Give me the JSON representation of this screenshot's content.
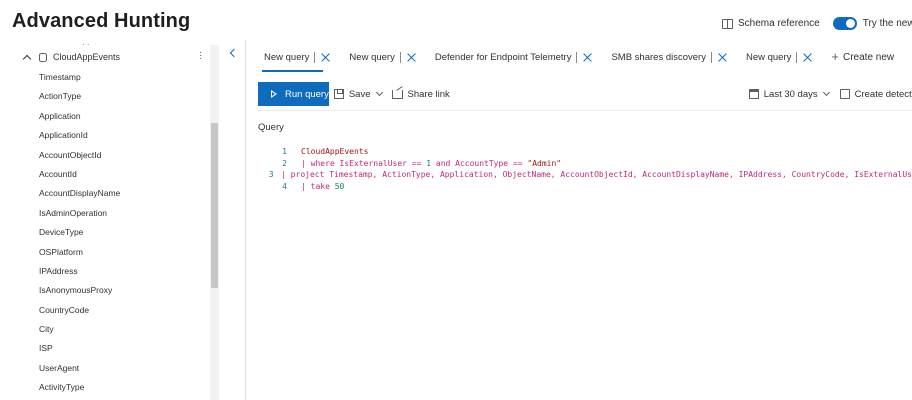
{
  "page": {
    "title": "Advanced Hunting"
  },
  "header": {
    "schema_reference": "Schema reference",
    "toggle_label": "Try the new Hunti",
    "toggle_on": true
  },
  "sidebar": {
    "group": "CloudAppEvents",
    "cut_text": "·  ·",
    "fields": [
      "Timestamp",
      "ActionType",
      "Application",
      "ApplicationId",
      "AccountObjectId",
      "AccountId",
      "AccountDisplayName",
      "IsAdminOperation",
      "DeviceType",
      "OSPlatform",
      "IPAddress",
      "IsAnonymousProxy",
      "CountryCode",
      "City",
      "ISP",
      "UserAgent",
      "ActivityType"
    ]
  },
  "tabs": [
    {
      "label": "New query",
      "active": true
    },
    {
      "label": "New query",
      "active": false
    },
    {
      "label": "Defender for Endpoint Telemetry",
      "active": false
    },
    {
      "label": "SMB shares discovery",
      "active": false
    },
    {
      "label": "New query",
      "active": false
    }
  ],
  "create_new": "Create new",
  "toolbar": {
    "run_query": "Run query",
    "save": "Save",
    "share_link": "Share link",
    "time_range": "Last 30 days",
    "create_detection": "Create detection ru"
  },
  "query_label": "Query",
  "editor": {
    "line_numbers": [
      "1",
      "2",
      "3",
      "4"
    ],
    "line1": "CloudAppEvents",
    "line2_a": "| where IsExternalUser == ",
    "line2_num": "1",
    "line2_b": " and AccountType == ",
    "line2_str": "\"Admin\"",
    "line3": "| project Timestamp, ActionType, Application, ObjectName, AccountObjectId, AccountDisplayName, IPAddress, CountryCode, IsExternalUs",
    "line4_a": "| take ",
    "line4_num": "50"
  },
  "colors": {
    "accent": "#0f6cbd",
    "keyword": "#a31515",
    "number": "#098658"
  }
}
